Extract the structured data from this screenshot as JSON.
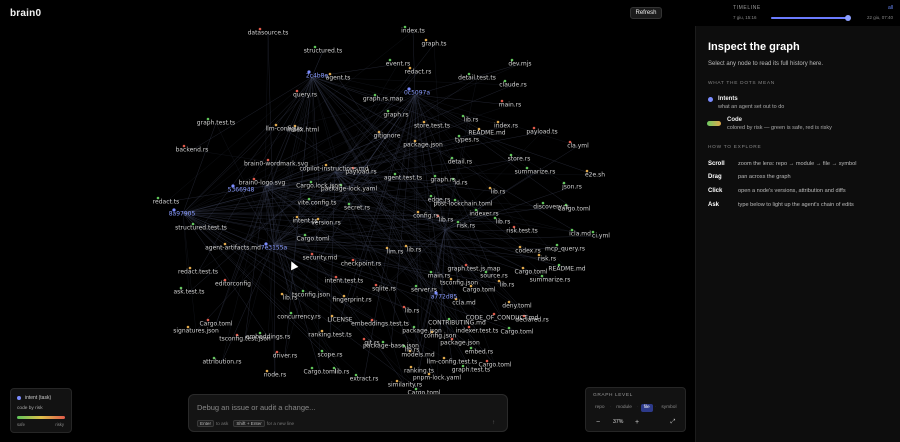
{
  "app": {
    "logo": "brain0",
    "refresh_label": "Refresh"
  },
  "timeline": {
    "title": "TIMELINE",
    "all_label": "all",
    "start_label": "7 giu, 15:16",
    "end_label": "22 giu, 07:40",
    "position_fraction": 0.99
  },
  "panel": {
    "title": "Inspect the graph",
    "subtitle": "Select any node to read its full history here.",
    "dots_heading": "WHAT THE DOTS MEAN",
    "intents_title": "Intents",
    "intents_desc": "what an agent set out to do",
    "code_title": "Code",
    "code_desc": "colored by risk — green is safe, red is risky",
    "explore_heading": "HOW TO EXPLORE",
    "explore": [
      {
        "key": "Scroll",
        "value": "zoom the lens: repo → module → file → symbol"
      },
      {
        "key": "Drag",
        "value": "pan across the graph"
      },
      {
        "key": "Click",
        "value": "open a node's versions, attribution and diffs"
      },
      {
        "key": "Ask",
        "value": "type below to light up the agent's chain of edits"
      }
    ]
  },
  "mini_legend": {
    "intent_label": "intent (task)",
    "code_label": "code by risk",
    "safe_label": "safe",
    "risky_label": "risky"
  },
  "chat": {
    "placeholder": "Debug an issue or audit a change...",
    "hint_key1": "Enter",
    "hint_text1": "to ask",
    "hint_key2": "Shift + Enter",
    "hint_text2": "for a new line",
    "send_icon": "arrow-up"
  },
  "graph_level": {
    "title": "GRAPH LEVEL",
    "tabs": [
      "repo",
      "module",
      "file",
      "symbol"
    ],
    "active_tab": "file",
    "zoom_label": "37%"
  },
  "colors": {
    "intent": "#7b8cff",
    "safe": "#5fc45a",
    "risky": "#e05a4a",
    "mid": "#e0a84b",
    "edge": "#3a3f55"
  },
  "graph": {
    "labels": [
      "datasource.ts",
      "index.ts",
      "graph.ts",
      "structured.ts",
      "2c4b8e",
      "agent.ts",
      "event.rs",
      "redact.rs",
      "dev.mjs",
      "detail.test.ts",
      "claude.rs",
      "query.rs",
      "0c5097a",
      "graph.rs.map",
      "graph.rs",
      "main.rs",
      "lib.rs",
      "index.rs",
      "graph.test.ts",
      "llm-config.ts",
      "index.html",
      "store.test.ts",
      "README.md",
      "payload.ts",
      "gitignore",
      "types.rs",
      "cla.yml",
      "backend.rs",
      "package.json",
      "brain0-wordmark.svg",
      "copilot-instructions.md",
      "detail.rs",
      "store.rs",
      "summarize.rs",
      "e2e.sh",
      "brain0-logo.svg",
      "payload.rs",
      "agent.test.ts",
      "graph.rs",
      "id.rs",
      "json.rs",
      "Cargo.lock.json",
      "5366948",
      "package-lock.yaml",
      "lib.rs",
      "redact.ts",
      "vite.config.ts",
      "secret.rs",
      "edge.rs",
      "discovery.rs",
      "Cargo.toml",
      "8a97905",
      "post-lockchain.toml",
      "config.rs",
      "indexer.rs",
      "structured.test.ts",
      "intent.ts",
      "version.rs",
      "lib.rs",
      "risk.rs",
      "lib.rs",
      "risk.test.ts",
      "icla.md",
      "ci.yml",
      "Cargo.toml",
      "agent-artifacts.md",
      "7e3155a",
      "llm.rs",
      "lib.rs",
      "codex.rs",
      "mcp_query.rs",
      "security.md",
      "graph.test.js.map",
      "checkpoint.rs",
      "risk.rs",
      "README.md",
      "redact.test.ts",
      "main.rs",
      "source.rs",
      "Cargo.toml",
      "summarize.rs",
      "intent.test.ts",
      "tsconfig.json",
      "editorconfig",
      "lib.rs",
      "ask.test.ts",
      "Cargo.toml",
      "lib.rs",
      "tsconfig.json",
      "sqlite.rs",
      "server.rs",
      "a772d85",
      "fingerprint.rs",
      "deny.toml",
      "ccla.md",
      "lib.rs",
      "CODE_OF_CONDUCT.md",
      "declared.rs",
      "concurrency.rs",
      "LICENSE",
      "CONTRIBUTING.md",
      "Cargo.toml",
      "embeddings.test.ts",
      "package.json",
      "indexer.test.ts",
      "Cargo.toml",
      "signatures.json",
      "ranking.test.ts",
      "tsconfig.test.json",
      "embeddings.rs",
      "config.json",
      "package.json",
      "git.rs",
      "package-base.json",
      "lib.rs",
      "embed.rs",
      "scope.rs",
      "models.md",
      "driver.rs",
      "attribution.rs",
      "llm-config.test.ts",
      "Cargo.toml",
      "Cargo.toml",
      "lib.rs",
      "ranking.ts",
      "graph.test.ts",
      "node.rs",
      "extract.rs",
      "pnpm-lock.yaml",
      "similarity.rs",
      "Cargo.toml",
      "lib.rs"
    ]
  }
}
